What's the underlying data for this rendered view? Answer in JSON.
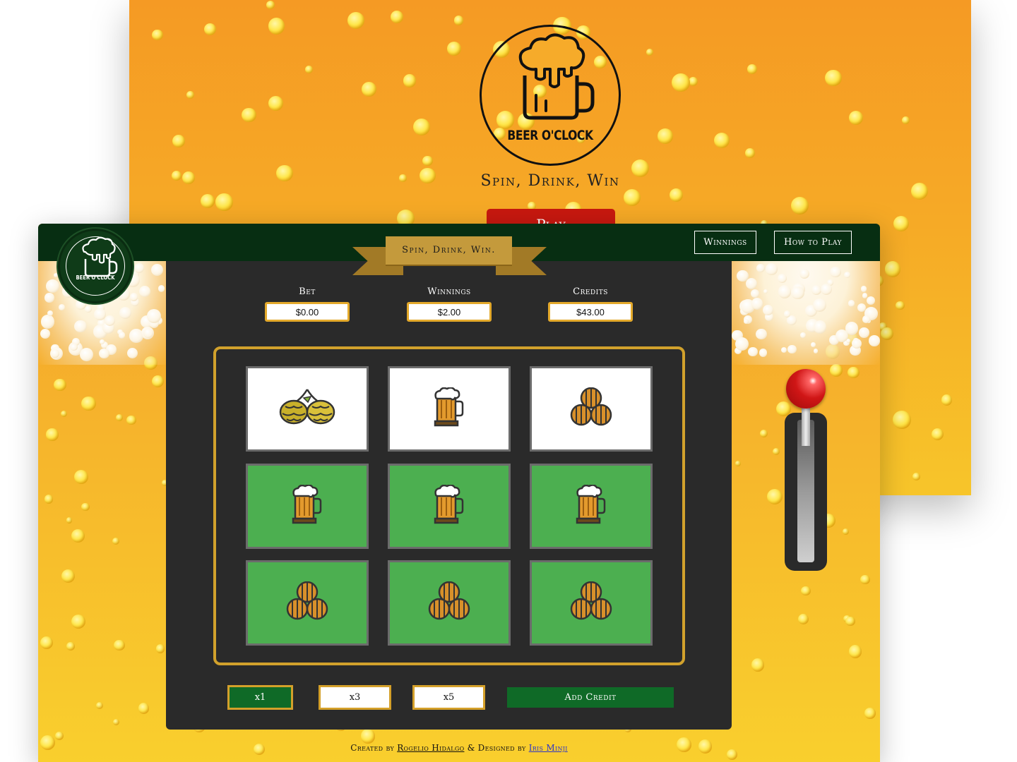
{
  "landing": {
    "logo_text": "BEER O'CLOCK",
    "tagline": "Spin, Drink, Win",
    "play_label": "Play"
  },
  "nav": {
    "winnings_label": "Winnings",
    "how_to_play_label": "How to Play"
  },
  "header": {
    "logo_text": "BEER O'CLOCK",
    "banner": "Spin, Drink, Win."
  },
  "stats": {
    "bet": {
      "label": "Bet",
      "value": "$0.00"
    },
    "winnings": {
      "label": "Winnings",
      "value": "$2.00"
    },
    "credits": {
      "label": "Credits",
      "value": "$43.00"
    }
  },
  "reels": [
    [
      {
        "icon": "hops-icon",
        "state": "idle"
      },
      {
        "icon": "beer-mug-icon",
        "state": "idle"
      },
      {
        "icon": "barrels-icon",
        "state": "idle"
      }
    ],
    [
      {
        "icon": "beer-mug-icon",
        "state": "win"
      },
      {
        "icon": "beer-mug-icon",
        "state": "win"
      },
      {
        "icon": "beer-mug-icon",
        "state": "win"
      }
    ],
    [
      {
        "icon": "barrels-icon",
        "state": "win"
      },
      {
        "icon": "barrels-icon",
        "state": "win"
      },
      {
        "icon": "barrels-icon",
        "state": "win"
      }
    ]
  ],
  "controls": {
    "x1": "x1",
    "x3": "x3",
    "x5": "x5",
    "add_credit": "Add Credit",
    "selected_multiplier": "x1"
  },
  "footer": {
    "created_by": "Created by",
    "creator": "Rogelio Hidalgo",
    "designed_by": "& Designed by",
    "designer": "Iris Minji"
  },
  "colors": {
    "topbar": "#072e12",
    "win_cell": "#4caf50",
    "accent_gold": "#d4a02a",
    "machine": "#2a2a2a",
    "play_button": "#c8180f"
  }
}
